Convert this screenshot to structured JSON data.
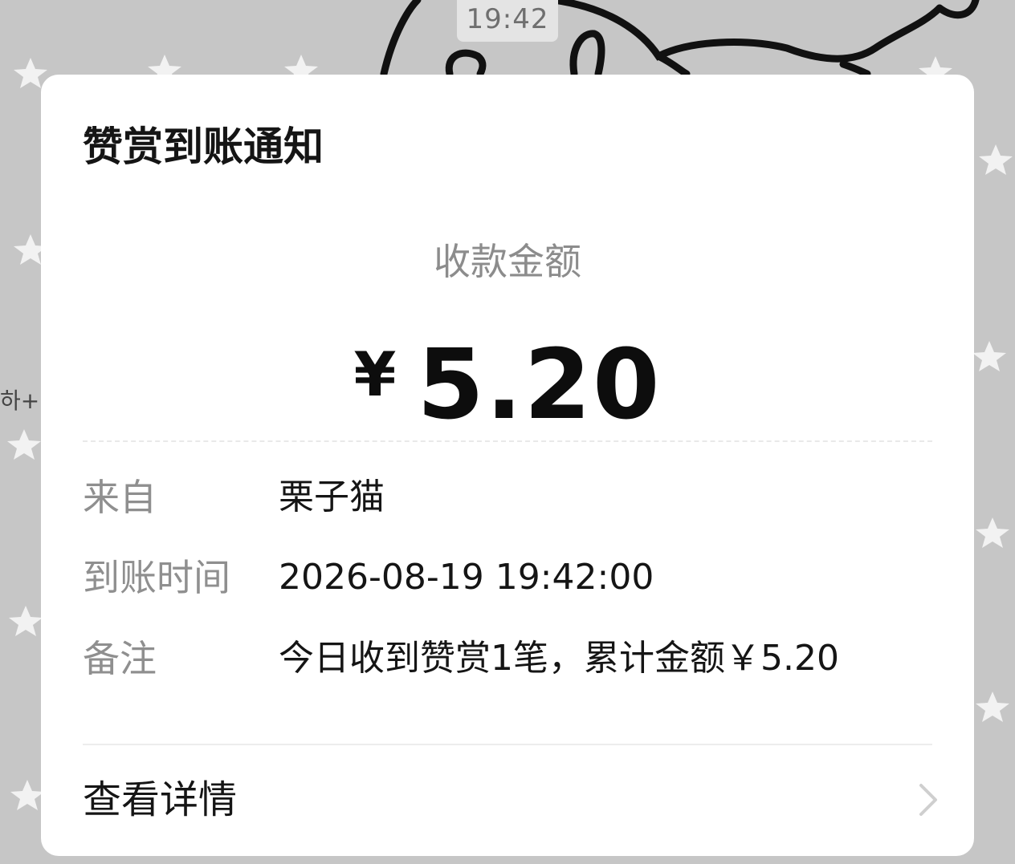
{
  "status_time": "19:42",
  "side_text": "하+",
  "card": {
    "title": "赞赏到账通知",
    "amount_label": "收款金额",
    "amount": {
      "currency": "¥",
      "value": "5.20"
    },
    "rows": [
      {
        "label": "来自",
        "value": "栗子猫"
      },
      {
        "label": "到账时间",
        "value": "2026-08-19 19:42:00"
      },
      {
        "label": "备注",
        "value": "今日收到赞赏1笔，累计金额￥5.20"
      }
    ],
    "details_label": "查看详情"
  },
  "icons": {
    "chevron": "chevron-right-icon",
    "background": "star-pattern"
  },
  "colors": {
    "background": "#c6c6c6",
    "card": "#ffffff",
    "muted_text": "#8f8f8f",
    "primary_text": "#151515"
  }
}
